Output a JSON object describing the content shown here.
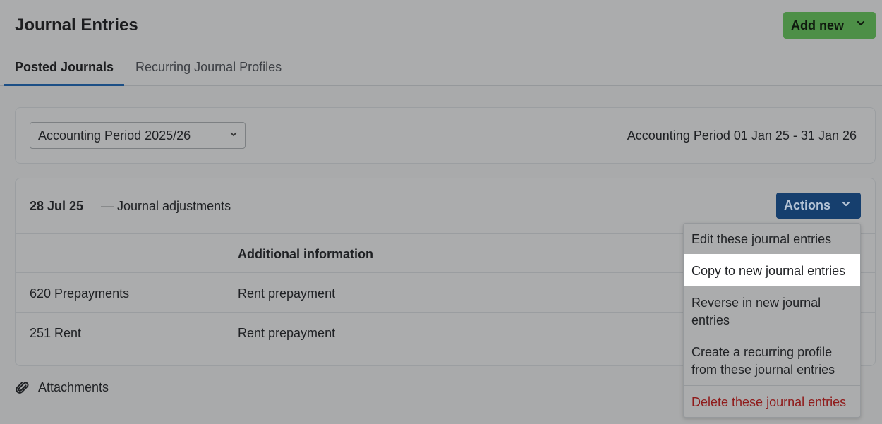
{
  "header": {
    "title": "Journal Entries",
    "add_new_label": "Add new",
    "tabs": [
      {
        "label": "Posted Journals",
        "active": true
      },
      {
        "label": "Recurring Journal Profiles",
        "active": false
      }
    ]
  },
  "period": {
    "selected": "Accounting Period 2025/26",
    "range": "Accounting Period 01 Jan 25 - 31 Jan 26"
  },
  "journal": {
    "date": "28 Jul 25",
    "description": "— Journal adjustments",
    "actions_label": "Actions",
    "columns": [
      "",
      "Additional information"
    ],
    "rows": [
      {
        "account": "620 Prepayments",
        "info": "Rent prepayment"
      },
      {
        "account": "251 Rent",
        "info": "Rent prepayment"
      }
    ]
  },
  "attachments_label": "Attachments",
  "menu": {
    "items": [
      {
        "label": "Edit these journal entries"
      },
      {
        "label": "Copy to new journal entries"
      },
      {
        "label": "Reverse in new journal entries"
      },
      {
        "label": "Create a recurring profile from these journal entries"
      },
      {
        "label": "Delete these journal entries"
      }
    ]
  },
  "colors": {
    "add_new": "#4d8f47",
    "actions": "#163f6e",
    "active_tab_underline": "#1c4f86",
    "danger": "#8f1b1b"
  }
}
